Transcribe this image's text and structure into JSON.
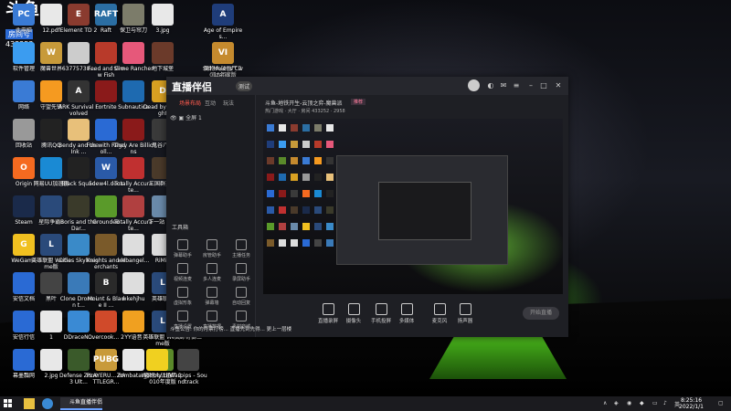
{
  "overlay": {
    "logo": "斗鱼",
    "room_label": "房间号",
    "room_number": "433252"
  },
  "desktop_icons": [
    {
      "label": "此电脑",
      "color": "#3a7bd5",
      "glyph": "PC"
    },
    {
      "label": "12.pdf",
      "color": "#e8e8e8",
      "glyph": ""
    },
    {
      "label": "Element TD 2",
      "color": "#8a3b2f",
      "glyph": "E"
    },
    {
      "label": "Raft",
      "color": "#2b6ea3",
      "glyph": "RAFT"
    },
    {
      "label": "保卫与帘刀",
      "color": "#7c7c6a",
      "glyph": ""
    },
    {
      "label": "3.jpg",
      "color": "#e8e8e8",
      "glyph": ""
    },
    {
      "label": "Age of Empires...",
      "color": "#1f3d7a",
      "glyph": "A"
    },
    {
      "label": "软件管理",
      "color": "#3b9cf0",
      "glyph": ""
    },
    {
      "label": "魔兽世界",
      "color": "#c79a3a",
      "glyph": "W"
    },
    {
      "label": "63775738...",
      "color": "#cccccc",
      "glyph": ""
    },
    {
      "label": "Feed and Grow Fish",
      "color": "#b83a2a",
      "glyph": ""
    },
    {
      "label": "Slime Rancher",
      "color": "#e6587a",
      "glyph": ""
    },
    {
      "label": "地下城堡",
      "color": "#6b3a2a",
      "glyph": ""
    },
    {
      "label": "魔物大战僵尸 2010年度版",
      "color": "#5a8a2a",
      "glyph": ""
    },
    {
      "label": "Sid Meier's Civilizatio...",
      "color": "#c58a2e",
      "glyph": "VI"
    },
    {
      "label": "网络",
      "color": "#3a7bd5",
      "glyph": ""
    },
    {
      "label": "守望先锋",
      "color": "#f59a20",
      "glyph": ""
    },
    {
      "label": "ARK Survival Evolved",
      "color": "#333333",
      "glyph": "A"
    },
    {
      "label": "Fortnite",
      "color": "#8a1a1a",
      "glyph": ""
    },
    {
      "label": "Subnautica",
      "color": "#1e6ab0",
      "glyph": ""
    },
    {
      "label": "Dead by Daylight",
      "color": "#d8a022",
      "glyph": "D"
    },
    {
      "label": "回收站",
      "color": "#999999",
      "glyph": ""
    },
    {
      "label": "腾讯QQ",
      "color": "#222222",
      "glyph": ""
    },
    {
      "label": "Bendy and the Ink ...",
      "color": "#e8c07a",
      "glyph": ""
    },
    {
      "label": "Fun with Ragdoll...",
      "color": "#2a6ad4",
      "glyph": ""
    },
    {
      "label": "They Are Billions",
      "color": "#8a1a1a",
      "glyph": ""
    },
    {
      "label": "鬼谷八荒",
      "color": "#3a3a3a",
      "glyph": ""
    },
    {
      "label": "Origin",
      "color": "#f56a20",
      "glyph": "O"
    },
    {
      "label": "网易UU加速器",
      "color": "#1a8ad4",
      "glyph": ""
    },
    {
      "label": "Black Squad",
      "color": "#222222",
      "glyph": ""
    },
    {
      "label": "5oew4l.docx",
      "color": "#2a5aa8",
      "glyph": "W"
    },
    {
      "label": "Totally Accurate...",
      "color": "#c03030",
      "glyph": ""
    },
    {
      "label": "三国群英传",
      "color": "#4a3a2a",
      "glyph": ""
    },
    {
      "label": "Steam",
      "color": "#1a2a4a",
      "glyph": ""
    },
    {
      "label": "星际争霸II",
      "color": "#2a4a7a",
      "glyph": ""
    },
    {
      "label": "Boris and the Dar...",
      "color": "#3a3a2a",
      "glyph": ""
    },
    {
      "label": "Grounded",
      "color": "#5a9a2a",
      "glyph": ""
    },
    {
      "label": "Totally Accurate...",
      "color": "#b04040",
      "glyph": ""
    },
    {
      "label": "下一站 江...",
      "color": "#6a8aaa",
      "glyph": ""
    },
    {
      "label": "WeGame",
      "color": "#f0c020",
      "glyph": "G"
    },
    {
      "label": "英雄联盟 WeGame版",
      "color": "#2a4a7a",
      "glyph": "L"
    },
    {
      "label": "Cities Skylines",
      "color": "#3a8ac8",
      "glyph": ""
    },
    {
      "label": "Knights and Merchants",
      "color": "#7a5a2a",
      "glyph": ""
    },
    {
      "label": "webangel...",
      "color": "#dddddd",
      "glyph": ""
    },
    {
      "label": "RiMiT",
      "color": "#dddddd",
      "glyph": ""
    },
    {
      "label": "安信文档",
      "color": "#2a6ad4",
      "glyph": ""
    },
    {
      "label": "黑叶",
      "color": "#444444",
      "glyph": ""
    },
    {
      "label": "Clone Drone in t...",
      "color": "#3a7ab8",
      "glyph": ""
    },
    {
      "label": "Mount & Blade II ...",
      "color": "#2a2a2a",
      "glyph": "B"
    },
    {
      "label": "wkehjhu",
      "color": "#dddddd",
      "glyph": ""
    },
    {
      "label": "英雄联盟",
      "color": "#2a4a7a",
      "glyph": "L"
    },
    {
      "label": "安信行信",
      "color": "#2a6ad4",
      "glyph": ""
    },
    {
      "label": "1",
      "color": "#e8e8e8",
      "glyph": ""
    },
    {
      "label": "DDraceN...",
      "color": "#3a8ad4",
      "glyph": ""
    },
    {
      "label": "Overcook... 2",
      "color": "#d04a2a",
      "glyph": ""
    },
    {
      "label": "YY语音",
      "color": "#f0a020",
      "glyph": ""
    },
    {
      "label": "英雄联盟 WeGame版",
      "color": "#2a4a7a",
      "glyph": "L"
    },
    {
      "label": "幕墨瓢网",
      "color": "#2a6ad4",
      "glyph": ""
    },
    {
      "label": "2.jpg",
      "color": "#e8e8e8",
      "glyph": ""
    },
    {
      "label": "Defense Zone 3 Ult...",
      "color": "#3a5a2a",
      "glyph": ""
    },
    {
      "label": "PLAYERU... BATTLEGR...",
      "color": "#c89a3a",
      "glyph": "PUBG"
    },
    {
      "label": "Zombatar_1",
      "color": "#e8e8e8",
      "glyph": ""
    },
    {
      "label": "植物大战僵尸 2010年度版",
      "color": "#5a8a2a",
      "glyph": ""
    },
    {
      "label": "Wobbly Life",
      "color": "#f0d020",
      "glyph": ""
    },
    {
      "label": "Warpips - Soundtrack",
      "color": "#444444",
      "glyph": ""
    },
    {
      "label": "天命奇御二",
      "color": "#3a2a2a",
      "glyph": ""
    }
  ],
  "app": {
    "brand": "直播伴侣",
    "version_badge": "测试",
    "left_tabs": [
      "场景布局",
      "互动",
      "玩法"
    ],
    "scene_name": "全屏 1",
    "tools_title": "工具箱",
    "tools": [
      "弹幕助手",
      "房管助手",
      "主播任务",
      "视频连麦",
      "多人连麦",
      "录屏助手",
      "虚拟形象",
      "弹幕墙",
      "自动回复",
      "直播设置",
      "直播数据",
      "素材商城"
    ],
    "notice": "斗鱼公告: 你的月票打榜... 直播先到先得... 更上一层楼",
    "room_title": "斗鱼-地铁开生-云顶之弈-魔兽派",
    "room_tag": "推荐",
    "room_sub": "热门游戏 · 大厅 · 房间 433252 · 2958",
    "bottom_items": [
      "直播录屏",
      "摄像头",
      "手机投屏",
      "多媒体",
      "麦克风",
      "扬声器"
    ],
    "start_label": "开始直播"
  },
  "taskbar": {
    "task_label": "斗鱼直播伴侣",
    "time": "8:25:16",
    "date": "2022/1/1"
  }
}
